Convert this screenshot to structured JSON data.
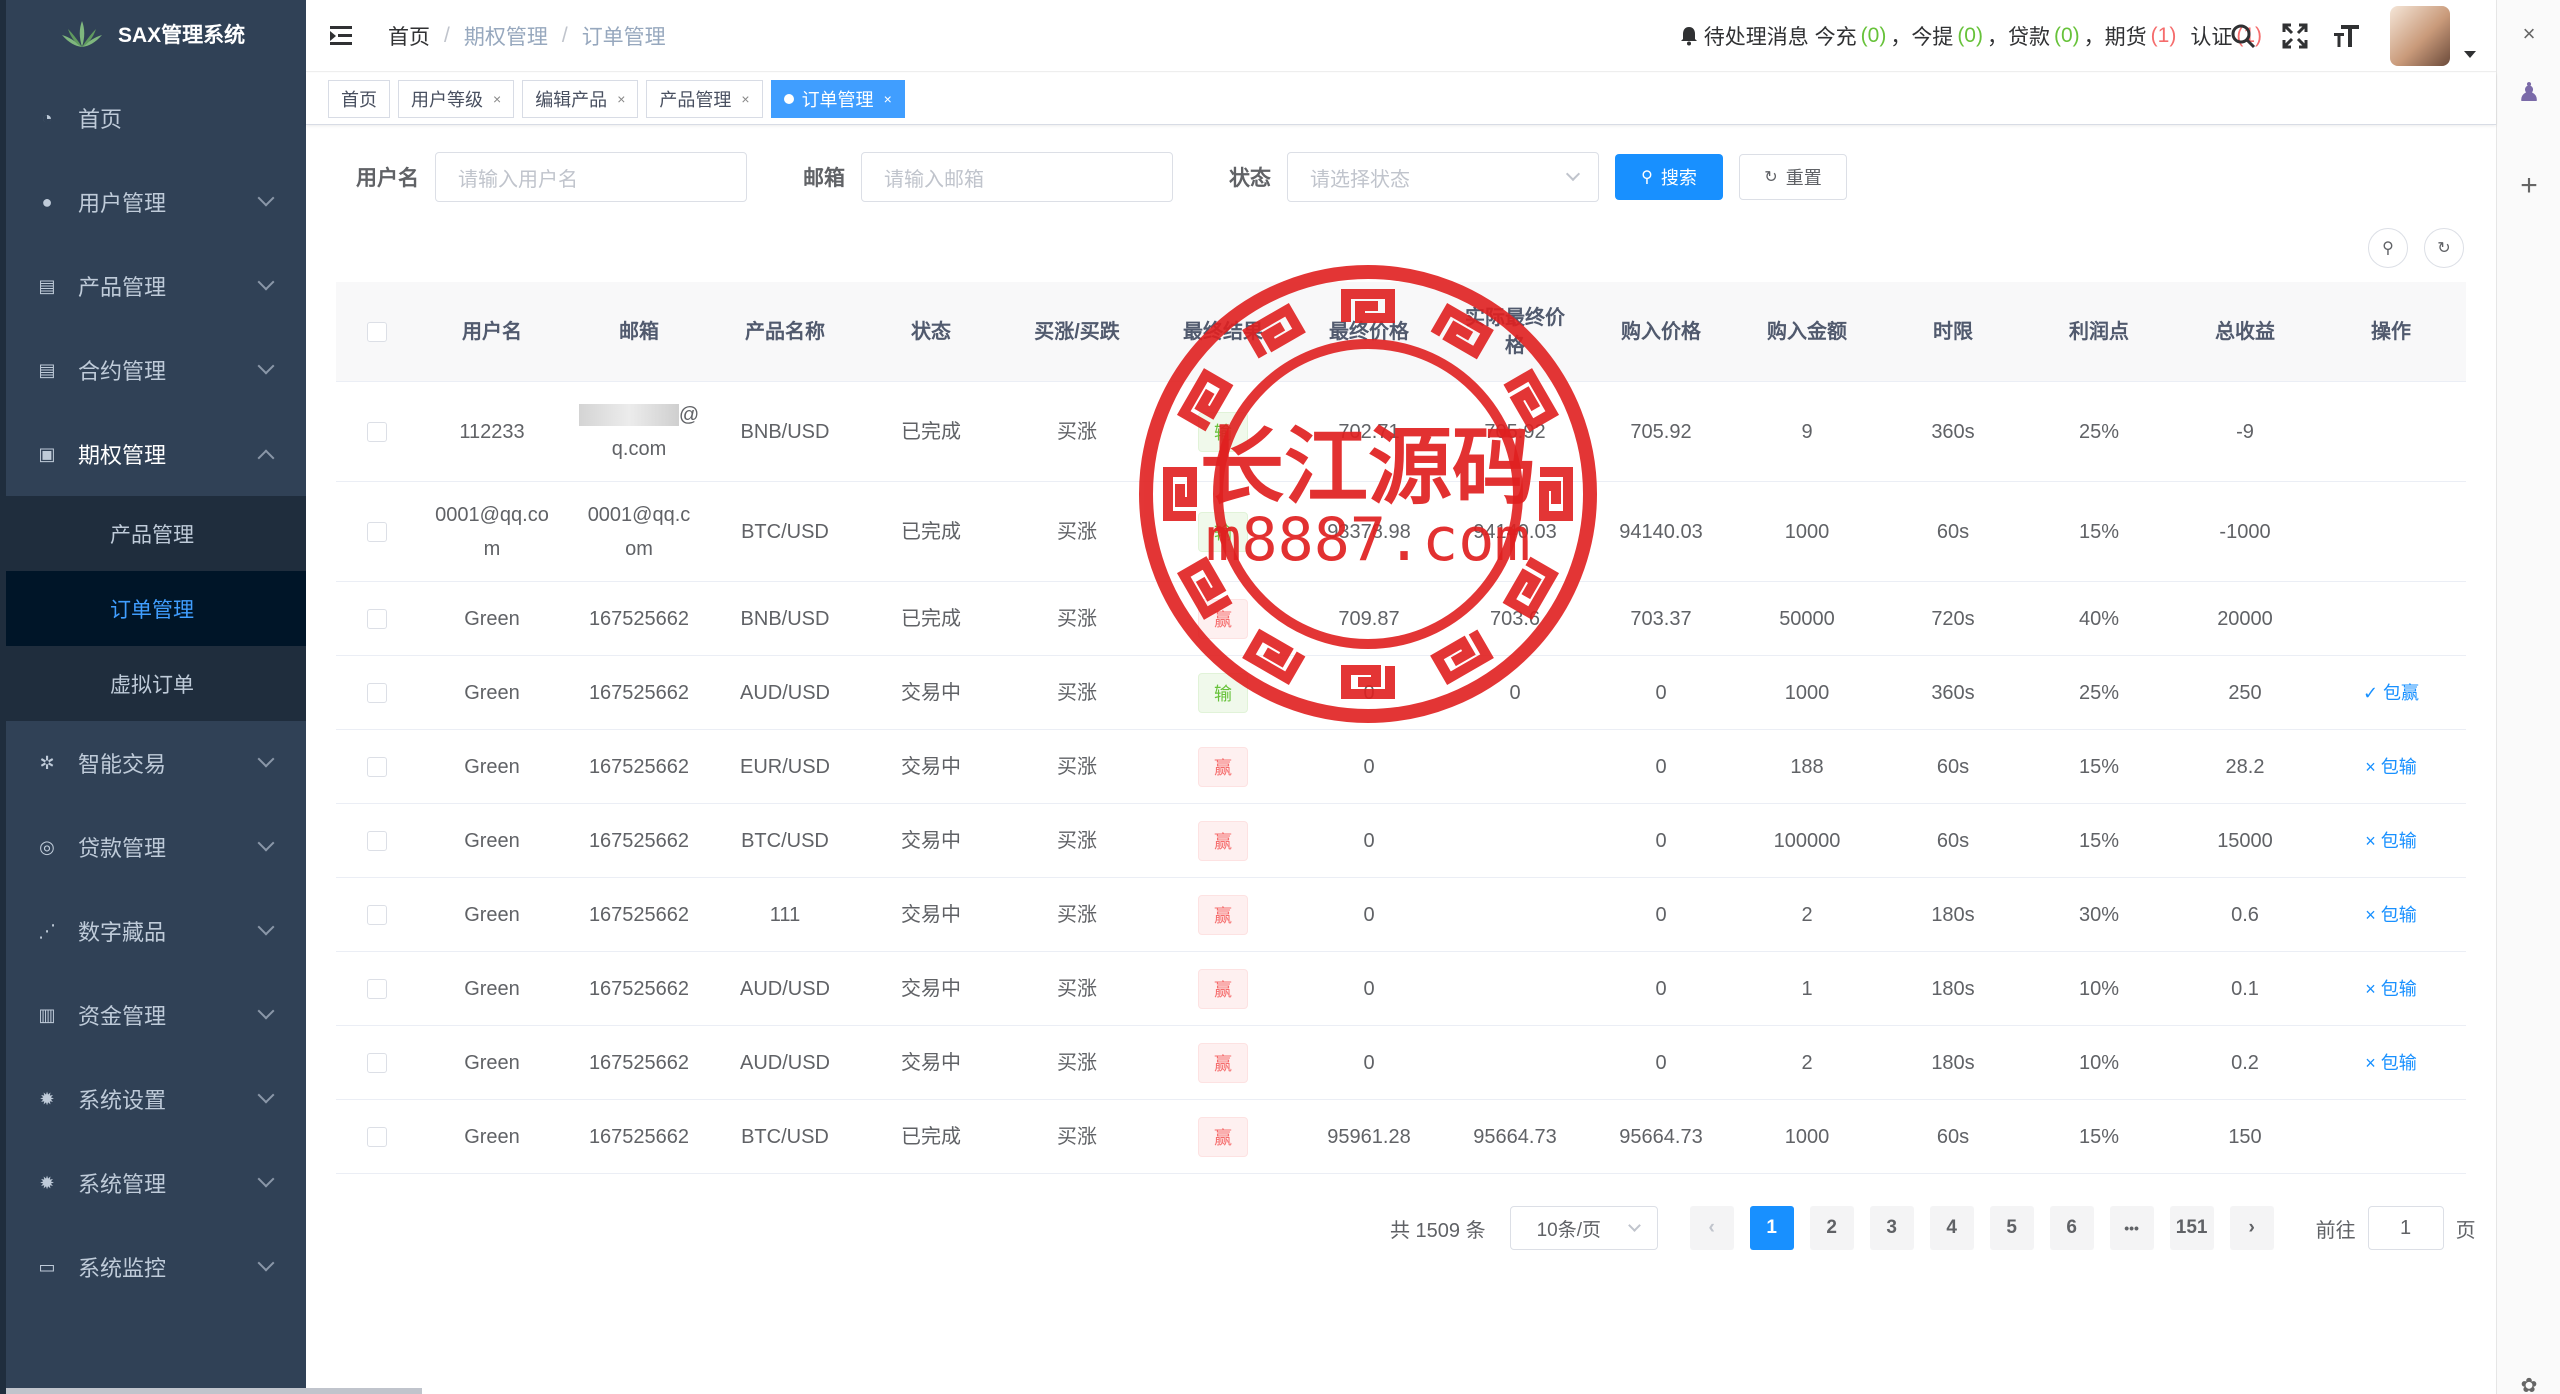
{
  "app": {
    "title": "SAX管理系统"
  },
  "sidebar": {
    "items": [
      {
        "label": "首页",
        "icon": "dashboard-icon"
      },
      {
        "label": "用户管理",
        "icon": "user-icon"
      },
      {
        "label": "产品管理",
        "icon": "document-icon"
      },
      {
        "label": "合约管理",
        "icon": "document-icon"
      },
      {
        "label": "期权管理",
        "icon": "chart-icon"
      },
      {
        "label": "智能交易",
        "icon": "gear-icon"
      },
      {
        "label": "贷款管理",
        "icon": "money-icon"
      },
      {
        "label": "数字藏品",
        "icon": "share-icon"
      },
      {
        "label": "资金管理",
        "icon": "wallet-icon"
      },
      {
        "label": "系统设置",
        "icon": "gear-icon"
      },
      {
        "label": "系统管理",
        "icon": "gear-icon"
      },
      {
        "label": "系统监控",
        "icon": "monitor-icon"
      }
    ],
    "sub": [
      "产品管理",
      "订单管理",
      "虚拟订单"
    ]
  },
  "breadcrumb": [
    "首页",
    "期权管理",
    "订单管理"
  ],
  "notice": {
    "label": "待处理消息 今充",
    "recharge": "(0)",
    "withdraw_label": "今提",
    "withdraw": "(0)",
    "loan_label": "贷款",
    "loan": "(0)",
    "futures_label": "期货",
    "futures": "(1)",
    "auth_label": "认证",
    "auth": "(1)"
  },
  "tags": [
    "首页",
    "用户等级",
    "编辑产品",
    "产品管理",
    "订单管理"
  ],
  "search": {
    "username_label": "用户名",
    "username_placeholder": "请输入用户名",
    "email_label": "邮箱",
    "email_placeholder": "请输入邮箱",
    "status_label": "状态",
    "status_placeholder": "请选择状态",
    "search_btn": "搜索",
    "reset_btn": "重置"
  },
  "table": {
    "headers": [
      "用户名",
      "邮箱",
      "产品名称",
      "状态",
      "买涨/买跌",
      "最终结果",
      "最终价格",
      "实际最终价格",
      "购入价格",
      "购入金额",
      "时限",
      "利润点",
      "总收益",
      "操作"
    ],
    "rows": [
      {
        "user": "112233",
        "email": "q.com",
        "email_blur": true,
        "product": "BNB/USD",
        "status": "已完成",
        "dir": "买涨",
        "result": "输",
        "final": "702.71",
        "actual": "705.92",
        "buy": "705.92",
        "amount": "9",
        "limit": "360s",
        "profit": "25%",
        "total": "-9",
        "op": ""
      },
      {
        "user": "0001@qq.com",
        "email": "0001@qq.com",
        "product": "BTC/USD",
        "status": "已完成",
        "dir": "买涨",
        "result": "输",
        "final": "93378.98",
        "actual": "94140.03",
        "buy": "94140.03",
        "amount": "1000",
        "limit": "60s",
        "profit": "15%",
        "total": "-1000",
        "op": ""
      },
      {
        "user": "Green",
        "email": "167525662",
        "product": "BNB/USD",
        "status": "已完成",
        "dir": "买涨",
        "result": "赢",
        "final": "709.87",
        "actual": "703.6",
        "buy": "703.37",
        "amount": "50000",
        "limit": "720s",
        "profit": "40%",
        "total": "20000",
        "op": ""
      },
      {
        "user": "Green",
        "email": "167525662",
        "product": "AUD/USD",
        "status": "交易中",
        "dir": "买涨",
        "result": "输",
        "final": "0",
        "actual": "0",
        "buy": "0",
        "amount": "1000",
        "limit": "360s",
        "profit": "25%",
        "total": "250",
        "op": "✓ 包赢"
      },
      {
        "user": "Green",
        "email": "167525662",
        "product": "EUR/USD",
        "status": "交易中",
        "dir": "买涨",
        "result": "赢",
        "final": "0",
        "actual": "",
        "buy": "0",
        "amount": "188",
        "limit": "60s",
        "profit": "15%",
        "total": "28.2",
        "op": "× 包输"
      },
      {
        "user": "Green",
        "email": "167525662",
        "product": "BTC/USD",
        "status": "交易中",
        "dir": "买涨",
        "result": "赢",
        "final": "0",
        "actual": "",
        "buy": "0",
        "amount": "100000",
        "limit": "60s",
        "profit": "15%",
        "total": "15000",
        "op": "× 包输"
      },
      {
        "user": "Green",
        "email": "167525662",
        "product": "111",
        "status": "交易中",
        "dir": "买涨",
        "result": "赢",
        "final": "0",
        "actual": "",
        "buy": "0",
        "amount": "2",
        "limit": "180s",
        "profit": "30%",
        "total": "0.6",
        "op": "× 包输"
      },
      {
        "user": "Green",
        "email": "167525662",
        "product": "AUD/USD",
        "status": "交易中",
        "dir": "买涨",
        "result": "赢",
        "final": "0",
        "actual": "",
        "buy": "0",
        "amount": "1",
        "limit": "180s",
        "profit": "10%",
        "total": "0.1",
        "op": "× 包输"
      },
      {
        "user": "Green",
        "email": "167525662",
        "product": "AUD/USD",
        "status": "交易中",
        "dir": "买涨",
        "result": "赢",
        "final": "0",
        "actual": "",
        "buy": "0",
        "amount": "2",
        "limit": "180s",
        "profit": "10%",
        "total": "0.2",
        "op": "× 包输"
      },
      {
        "user": "Green",
        "email": "167525662",
        "product": "BTC/USD",
        "status": "已完成",
        "dir": "买涨",
        "result": "赢",
        "final": "95961.28",
        "actual": "95664.73",
        "buy": "95664.73",
        "amount": "1000",
        "limit": "60s",
        "profit": "15%",
        "total": "150",
        "op": ""
      }
    ]
  },
  "pagination": {
    "total": "共 1509 条",
    "page_size": "10条/页",
    "pages": [
      "1",
      "2",
      "3",
      "4",
      "5",
      "6",
      "•••",
      "151"
    ],
    "goto_label": "前往",
    "goto_value": "1",
    "page_label": "页"
  },
  "watermark": {
    "line1": "长江源码",
    "line2": "m8887.com",
    "color": "#e02020"
  }
}
